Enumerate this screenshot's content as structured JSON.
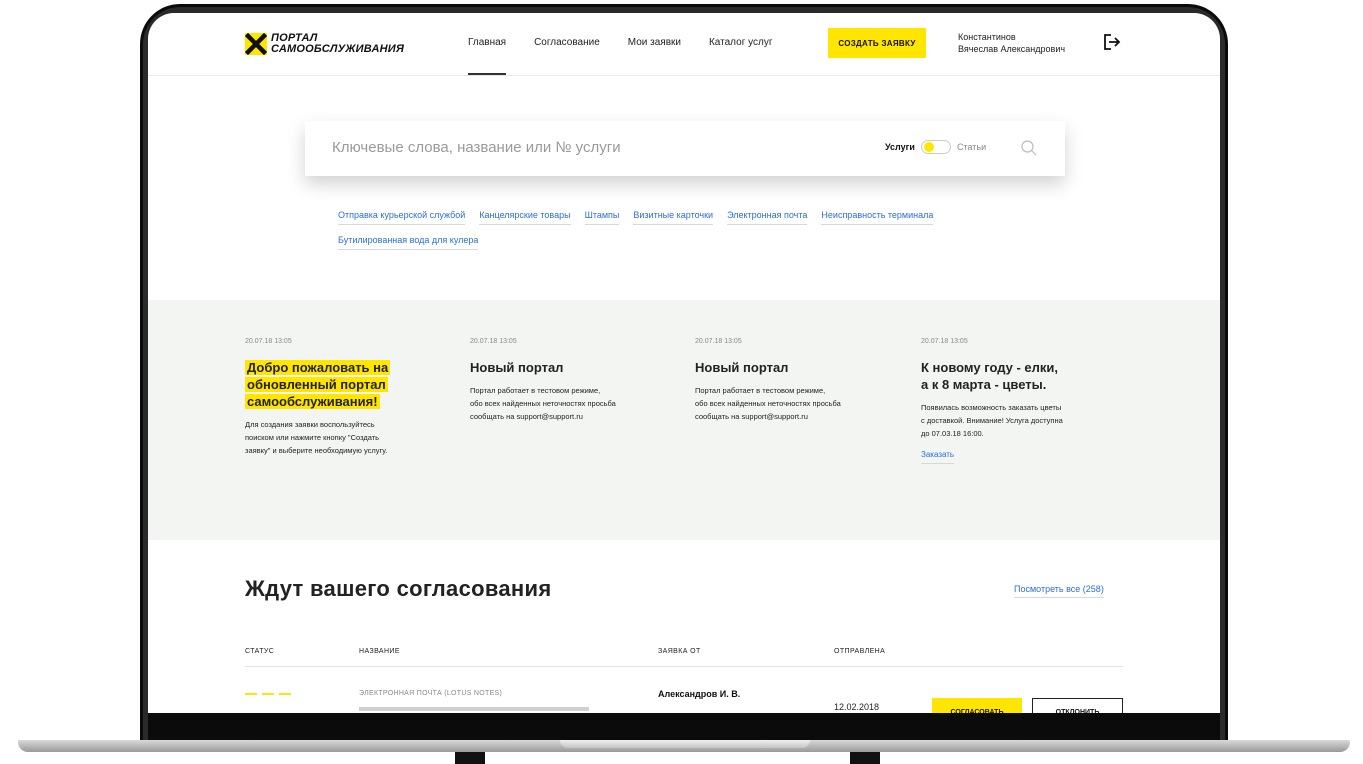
{
  "brand": {
    "logo_line1": "ПОРТАЛ",
    "logo_line2": "САМООБСЛУЖИВАНИЯ",
    "accent": "#ffe500",
    "link_color": "#2a6fd6"
  },
  "nav": {
    "items": [
      {
        "label": "Главная",
        "active": true
      },
      {
        "label": "Согласование"
      },
      {
        "label": "Мои заявки"
      },
      {
        "label": "Каталог услуг"
      }
    ],
    "create_label": "СОЗДАТЬ ЗАЯВКУ",
    "user_line1": "Константинов",
    "user_line2": "Вячеслав Александрович",
    "logout_icon": "logout-icon"
  },
  "search": {
    "placeholder": "Ключевые слова, название или № услуги",
    "toggle_left": "Услуги",
    "toggle_right": "Статьи",
    "icon": "search-icon"
  },
  "tags": [
    "Отправка курьерской службой",
    "Канцелярские товары",
    "Штампы",
    "Визитные карточки",
    "Электронная почта",
    "Неисправность терминала",
    "Бутилированная вода для кулера"
  ],
  "news": [
    {
      "date": "20.07.18  13:05",
      "title_lines": [
        "Добро пожаловать на",
        "обновленный портал",
        "самообслуживания!"
      ],
      "text_lines": [
        "Для создания заявки воспользуйтесь",
        "поиском или нажмите кнопку \"Создать",
        "заявку\" и выберите необходимую услугу."
      ]
    },
    {
      "date": "20.07.18  13:05",
      "title_lines": [
        "Новый портал"
      ],
      "text_lines": [
        "Портал работает в тестовом режиме,",
        "обо всех найденных неточностях просьба",
        "сообщать на support@support.ru"
      ]
    },
    {
      "date": "20.07.18  13:05",
      "title_lines": [
        "Новый портал"
      ],
      "text_lines": [
        "Портал работает в тестовом режиме,",
        "обо всех найденных неточностях просьба",
        "сообщать на support@support.ru"
      ]
    },
    {
      "date": "20.07.18  13:05",
      "title_lines": [
        "К новому году - елки,",
        "а к 8 марта - цветы."
      ],
      "text_lines": [
        "Появилась возможность заказать цветы",
        "с доставкой. Внимание! Услуга доступна",
        "до 07.03.18 16:00."
      ],
      "link": "Заказать"
    }
  ],
  "approvals": {
    "title": "Ждут вашего согласования",
    "view_all": "Посмотреть все (258)",
    "columns": [
      "СТАТУС",
      "НАЗВАНИЕ",
      "ЗАЯВКА ОТ",
      "ОТПРАВЛЕНА"
    ],
    "rows": [
      {
        "service": "ЭЛЕКТРОННАЯ ПОЧТА (LOTUS NOTES)",
        "from": "Александров И. В.",
        "sent": "12.02.2018",
        "approve": "СОГЛАСОВАТЬ",
        "reject": "ОТКЛОНИТЬ"
      }
    ]
  }
}
